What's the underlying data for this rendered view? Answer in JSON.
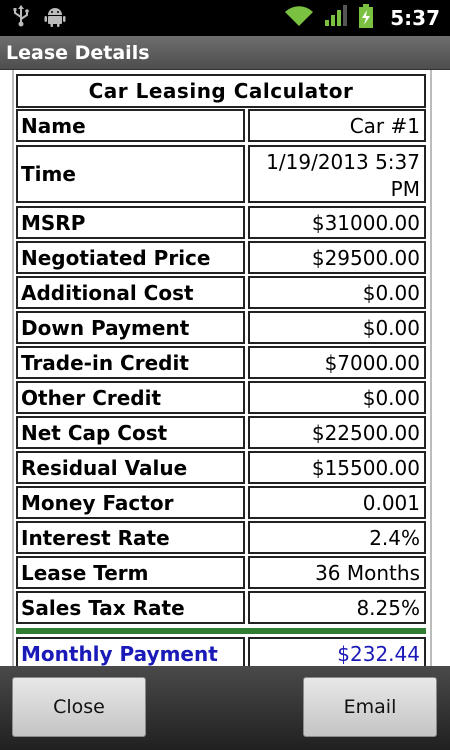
{
  "status_bar": {
    "time": "5:37",
    "icons": [
      "usb-icon",
      "android-icon",
      "wifi-icon",
      "signal-icon",
      "battery-icon"
    ]
  },
  "title_bar": {
    "title": "Lease Details"
  },
  "calculator": {
    "header": "Car Leasing Calculator",
    "rows": [
      {
        "label": "Name",
        "value": "Car #1"
      },
      {
        "label": "Time",
        "value": "1/19/2013 5:37 PM"
      },
      {
        "label": "MSRP",
        "value": "$31000.00"
      },
      {
        "label": "Negotiated Price",
        "value": "$29500.00"
      },
      {
        "label": "Additional Cost",
        "value": "$0.00"
      },
      {
        "label": "Down Payment",
        "value": "$0.00"
      },
      {
        "label": "Trade-in Credit",
        "value": "$7000.00"
      },
      {
        "label": "Other Credit",
        "value": "$0.00"
      },
      {
        "label": "Net Cap Cost",
        "value": "$22500.00"
      },
      {
        "label": "Residual Value",
        "value": "$15500.00"
      },
      {
        "label": "Money Factor",
        "value": "0.001"
      },
      {
        "label": "Interest Rate",
        "value": "2.4%"
      },
      {
        "label": "Lease Term",
        "value": "36 Months"
      },
      {
        "label": "Sales Tax Rate",
        "value": "8.25%"
      }
    ],
    "monthly": {
      "label": "Monthly Payment",
      "value": "$232.44"
    }
  },
  "buttons": {
    "close": "Close",
    "email": "Email"
  },
  "colors": {
    "monthly_text": "#1a1ab8",
    "divider": "#2e7d32",
    "battery": "#7ac142",
    "wifi": "#7ac142"
  }
}
